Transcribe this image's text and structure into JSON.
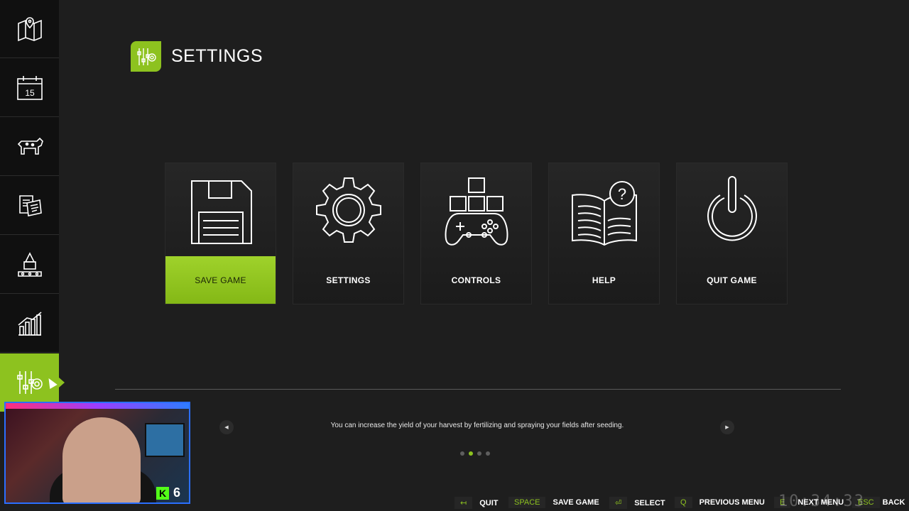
{
  "header": {
    "title": "SETTINGS",
    "icon": "sliders-gear-icon"
  },
  "sidebar": {
    "items": [
      {
        "icon": "map-icon",
        "active": false
      },
      {
        "icon": "calendar-icon",
        "date": "15",
        "active": false
      },
      {
        "icon": "animals-icon",
        "active": false
      },
      {
        "icon": "contracts-icon",
        "active": false
      },
      {
        "icon": "production-icon",
        "active": false
      },
      {
        "icon": "statistics-icon",
        "active": false
      },
      {
        "icon": "settings-sliders-icon",
        "active": true
      }
    ]
  },
  "menu": {
    "cards": [
      {
        "label": "SAVE GAME",
        "icon": "floppy-disk-icon",
        "selected": true
      },
      {
        "label": "SETTINGS",
        "icon": "gear-icon",
        "selected": false
      },
      {
        "label": "CONTROLS",
        "icon": "gamepad-icon",
        "selected": false
      },
      {
        "label": "HELP",
        "icon": "help-book-icon",
        "selected": false
      },
      {
        "label": "QUIT GAME",
        "icon": "power-icon",
        "selected": false
      }
    ]
  },
  "tips": {
    "text": "You can increase the yield of your harvest by fertilizing and spraying your fields after seeding.",
    "page_count": 4,
    "active_index": 1
  },
  "stream": {
    "kick_count": "6"
  },
  "hints": [
    {
      "key": "↤",
      "label": "QUIT"
    },
    {
      "key": "SPACE",
      "label": "SAVE GAME"
    },
    {
      "key": "⏎",
      "label": "SELECT"
    },
    {
      "key": "Q",
      "label": "PREVIOUS MENU"
    },
    {
      "key": "E",
      "label": "NEXT MENU"
    },
    {
      "key": "ESC",
      "label": "BACK"
    }
  ],
  "clock": "10:34:33",
  "colors": {
    "accent": "#8dc21f",
    "background": "#1e1e1e",
    "sidebar": "#101010"
  }
}
